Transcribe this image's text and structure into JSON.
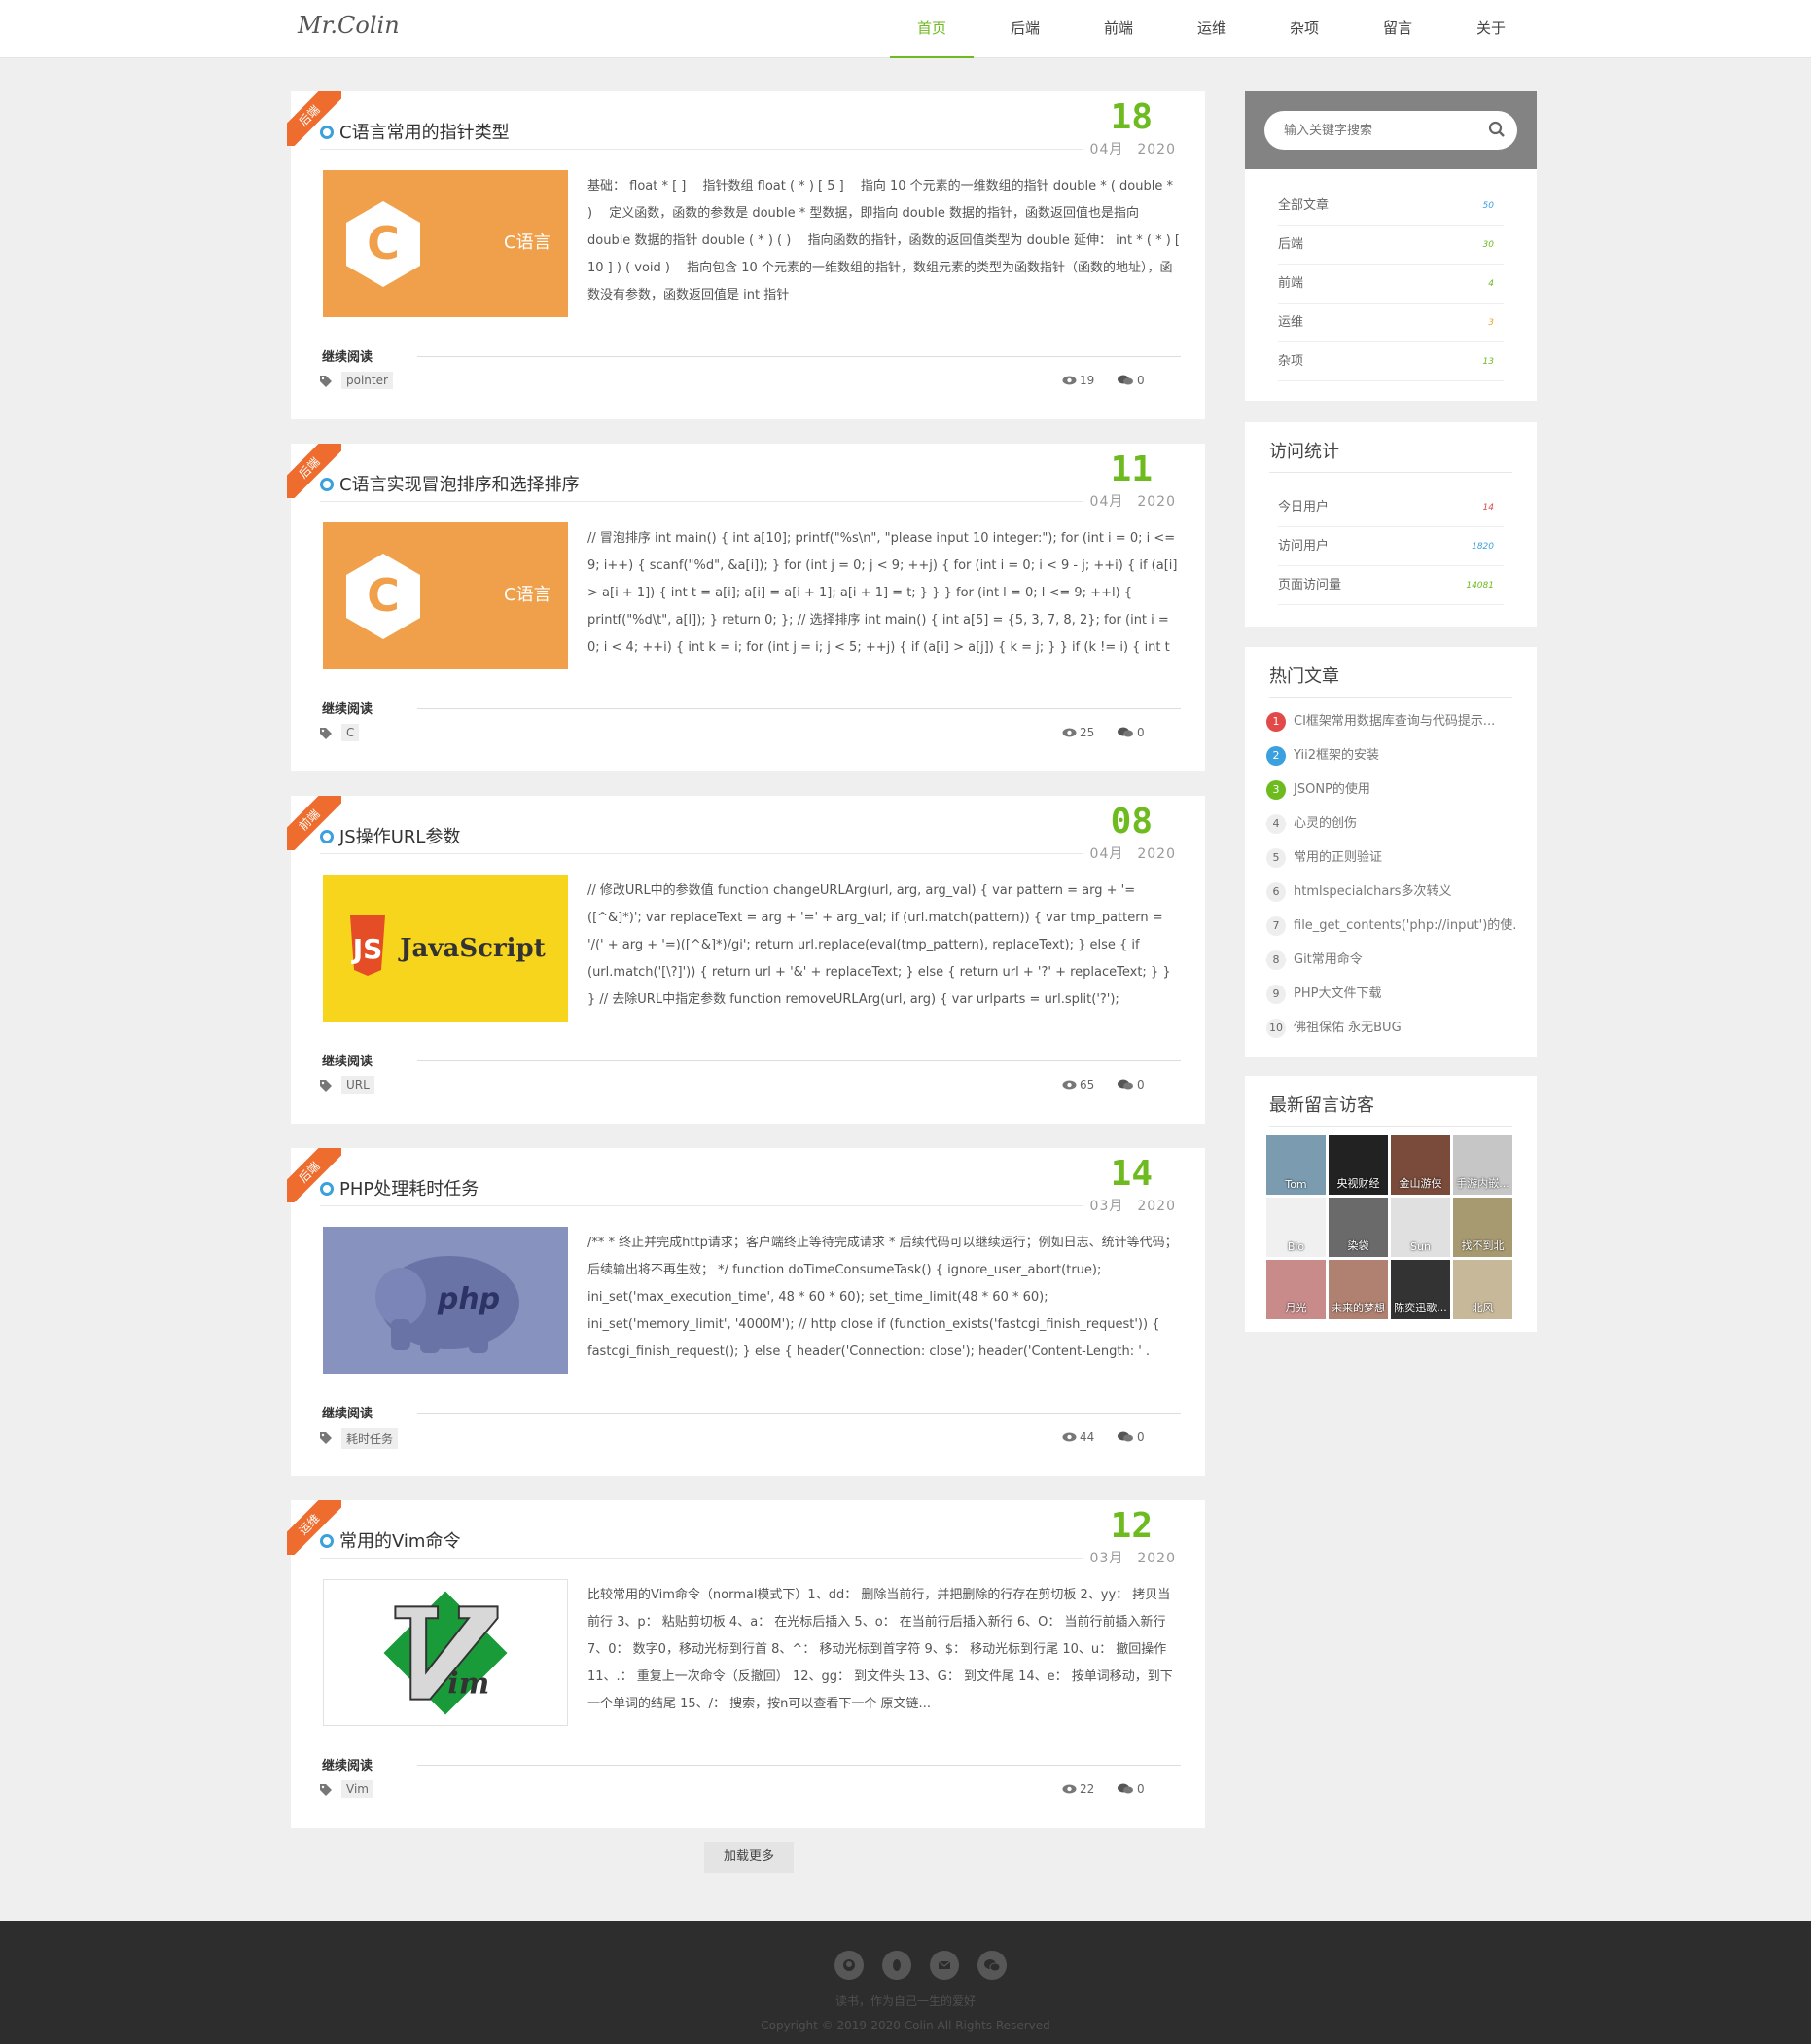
{
  "site": {
    "logo": "Mr.Colin"
  },
  "nav": [
    "首页",
    "后端",
    "前端",
    "运维",
    "杂项",
    "留言",
    "关于"
  ],
  "posts": [
    {
      "category": "后端",
      "title": "C语言常用的指针类型",
      "day": "18",
      "month": "04月",
      "year": "2020",
      "thumb_text": "C语言",
      "excerpt": "基础： float * [ ]　 指针数组  float ( * ) [ 5 ]　 指向 10 个元素的一维数组的指针  double * ( double * )　 定义函数，函数的参数是 double * 型数据，即指向 double 数据的指针，函数返回值也是指向 double 数据的指针  double ( * ) ( )　 指向函数的指针，函数的返回值类型为 double  延伸： int * ( * ) [ 10 ] ) ( void )　 指向包含 10 个元素的一维数组的指针，数组元素的类型为函数指针（函数的地址），函数没有参数，函数返回值是 int 指针",
      "read_more": "继续阅读",
      "tag": "pointer",
      "views": "19",
      "comments": "0"
    },
    {
      "category": "后端",
      "title": "C语言实现冒泡排序和选择排序",
      "day": "11",
      "month": "04月",
      "year": "2020",
      "thumb_text": "C语言",
      "excerpt": "// 冒泡排序 int main() { int a[10]; printf(\"%s\\n\", \"please input 10 integer:\"); for (int i = 0; i <= 9; i++) { scanf(\"%d\", &a[i]); } for (int j = 0; j < 9; ++j) { for (int i = 0; i < 9 - j; ++i) { if (a[i] > a[i + 1]) { int t = a[i]; a[i] = a[i + 1]; a[i + 1] = t; } } } for (int l = 0; l <= 9; ++l) { printf(\"%d\\t\", a[l]); } return 0; }; // 选择排序 int main() { int a[5] = {5, 3, 7, 8, 2}; for (int i = 0; i < 4; ++i) { int k = i; for (int j = i; j < 5; ++j) { if (a[i] > a[j]) { k = j; } } if (k != i) { int t = a[i]; a[i] = a[k]; a[k] = t; } } for (int k = 0; k < 5; ++k) {...",
      "read_more": "继续阅读",
      "tag": "C",
      "views": "25",
      "comments": "0"
    },
    {
      "category": "前端",
      "title": "JS操作URL参数",
      "day": "08",
      "month": "04月",
      "year": "2020",
      "thumb_text": "JavaScript",
      "excerpt": "// 修改URL中的参数值 function changeURLArg(url, arg, arg_val) { var pattern = arg + '=([^&]*)'; var replaceText = arg + '=' + arg_val; if (url.match(pattern)) { var tmp_pattern = '/(' + arg + '=)([^&]*)/gi'; return url.replace(eval(tmp_pattern), replaceText); } else { if (url.match('[\\?]')) { return url + '&' + replaceText; } else { return url + '?' + replaceText; } } } // 去除URL中指定参数 function removeURLArg(url, arg) { var urlparts = url.split('?'); if(urlparts.length >= 2) { var prefix =...",
      "read_more": "继续阅读",
      "tag": "URL",
      "views": "65",
      "comments": "0"
    },
    {
      "category": "后端",
      "title": "PHP处理耗时任务",
      "day": "14",
      "month": "03月",
      "year": "2020",
      "thumb_text": "php",
      "excerpt": "/** * 终止并完成http请求；客户端终止等待完成请求 * 后续代码可以继续运行；例如日志、统计等代码；后续输出将不再生效； */ function doTimeConsumeTask() { ignore_user_abort(true); ini_set('max_execution_time', 48 * 60 * 60); set_time_limit(48 * 60 * 60); ini_set('memory_limit', '4000M'); // http close if (function_exists('fastcgi_finish_request')) { fastcgi_finish_request(); } else { header('Connection: close'); header('Content-Length: ' . ob_get_length()); ob_start(); echo...",
      "read_more": "继续阅读",
      "tag": "耗时任务",
      "views": "44",
      "comments": "0"
    },
    {
      "category": "运维",
      "title": "常用的Vim命令",
      "day": "12",
      "month": "03月",
      "year": "2020",
      "thumb_text": "im",
      "excerpt": "比较常用的Vim命令（normal模式下）1、dd： 删除当前行，并把删除的行存在剪切板 2、yy： 拷贝当前行 3、p： 粘贴剪切板 4、a： 在光标后插入 5、o： 在当前行后插入新行 6、O： 当前行前插入新行 7、0： 数字0，移动光标到行首 8、^： 移动光标到首字符 9、$： 移动光标到行尾 10、u： 撤回操作 11、.： 重复上一次命令（反撤回） 12、gg： 到文件头 13、G： 到文件尾 14、e： 按单词移动，到下一个单词的结尾 15、/： 搜索，按n可以查看下一个 原文链...",
      "read_more": "继续阅读",
      "tag": "Vim",
      "views": "22",
      "comments": "0"
    }
  ],
  "load_more": "加载更多",
  "sidebar": {
    "search_placeholder": "输入关键字搜索",
    "categories": [
      {
        "name": "全部文章",
        "count": "50",
        "color": "#3aa0de"
      },
      {
        "name": "后端",
        "count": "30",
        "color": "#6dbb1f"
      },
      {
        "name": "前端",
        "count": "4",
        "color": "#6dbb1f"
      },
      {
        "name": "运维",
        "count": "3",
        "color": "#f0a020"
      },
      {
        "name": "杂项",
        "count": "13",
        "color": "#6dbb1f"
      }
    ],
    "stats_title": "访问统计",
    "stats": [
      {
        "name": "今日用户",
        "count": "14",
        "color": "#e24a4a"
      },
      {
        "name": "访问用户",
        "count": "1820",
        "color": "#3aa0de"
      },
      {
        "name": "页面访问量",
        "count": "14081",
        "color": "#6dbb1f"
      }
    ],
    "hot_title": "热门文章",
    "hot": [
      {
        "n": "1",
        "t": "CI框架常用数据库查询与代码提示...",
        "c": "#e24a4a"
      },
      {
        "n": "2",
        "t": "Yii2框架的安装",
        "c": "#3aa0de"
      },
      {
        "n": "3",
        "t": "JSONP的使用",
        "c": "#6dbb1f"
      },
      {
        "n": "4",
        "t": "心灵的创伤",
        "c": ""
      },
      {
        "n": "5",
        "t": "常用的正则验证",
        "c": ""
      },
      {
        "n": "6",
        "t": "htmlspecialchars多次转义",
        "c": ""
      },
      {
        "n": "7",
        "t": "file_get_contents('php://input')的使...",
        "c": ""
      },
      {
        "n": "8",
        "t": "Git常用命令",
        "c": ""
      },
      {
        "n": "9",
        "t": "PHP大文件下载",
        "c": ""
      },
      {
        "n": "10",
        "t": "佛祖保佑 永无BUG",
        "c": ""
      }
    ],
    "visitors_title": "最新留言访客",
    "visitors": [
      {
        "name": "Tom",
        "bg": "#7a9bb0"
      },
      {
        "name": "央视财经",
        "bg": "#222"
      },
      {
        "name": "金山游侠",
        "bg": "#7a4a3a"
      },
      {
        "name": "手游内嵌...",
        "bg": "#c6c6c6"
      },
      {
        "name": "Bio",
        "bg": "#f0f0f0"
      },
      {
        "name": "染袋",
        "bg": "#6a6a6a"
      },
      {
        "name": "Sun",
        "bg": "#e0e0e0"
      },
      {
        "name": "找不到北",
        "bg": "#a89a70"
      },
      {
        "name": "月光",
        "bg": "#c98a8a"
      },
      {
        "name": "未来的梦想",
        "bg": "#b08070"
      },
      {
        "name": "陈奕迅歌...",
        "bg": "#333"
      },
      {
        "name": "北风",
        "bg": "#c8b89a"
      }
    ]
  },
  "footer": {
    "icons": [
      "github-icon",
      "qq-icon",
      "mail-icon",
      "wechat-icon"
    ],
    "slogan": "读书，作为自己一生的爱好",
    "copyright": "Copyright © 2019-2020 Colin All Rights Reserved"
  },
  "colors": {
    "accent": "#6dbb1f",
    "ribbon": "#ee6d2e",
    "link_blue": "#3aa0de"
  }
}
